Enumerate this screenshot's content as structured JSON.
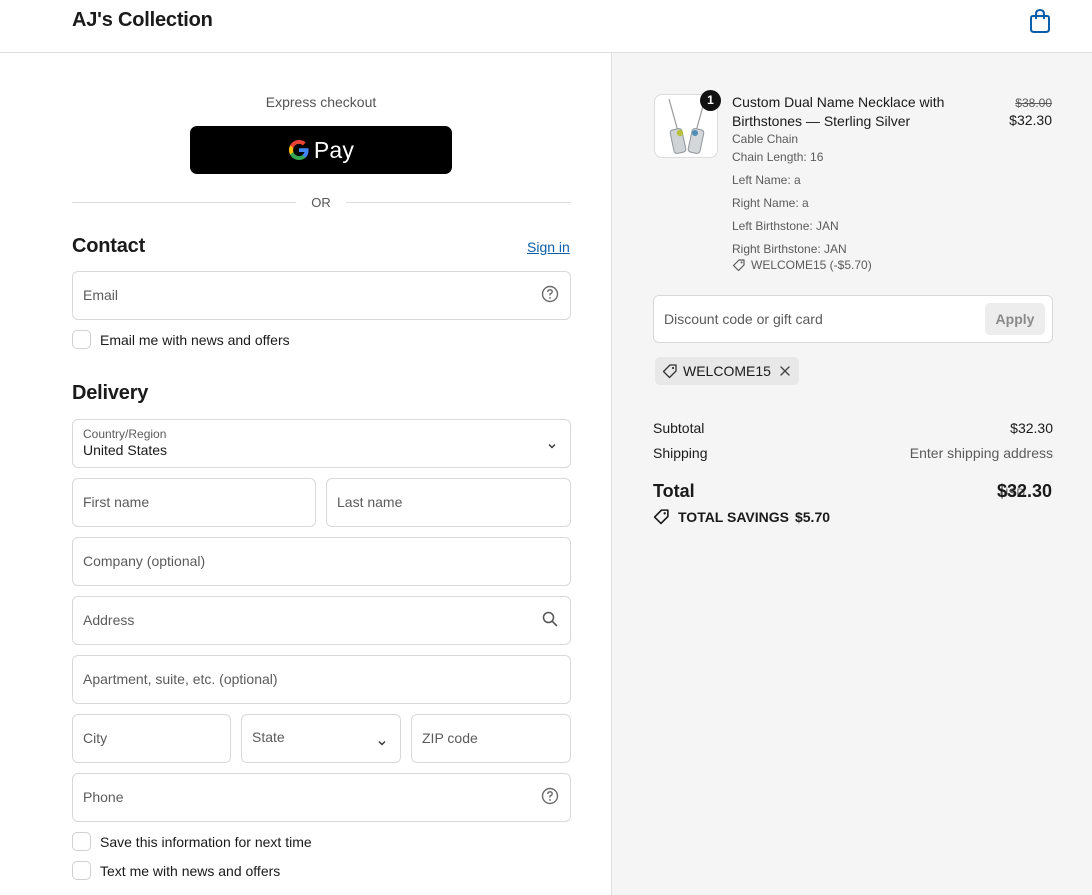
{
  "header": {
    "store_name": "AJ's Collection",
    "cart_icon": "shopping-bag-icon"
  },
  "checkout": {
    "express_label": "Express checkout",
    "gpay_label": "Pay",
    "or_label": "OR"
  },
  "contact": {
    "title": "Contact",
    "signin_label": "Sign in",
    "email_placeholder": "Email",
    "email_offers_label": "Email me with news and offers"
  },
  "delivery": {
    "title": "Delivery",
    "country_label": "Country/Region",
    "country_value": "United States",
    "first_name_placeholder": "First name",
    "last_name_placeholder": "Last name",
    "company_placeholder": "Company (optional)",
    "address_placeholder": "Address",
    "apartment_placeholder": "Apartment, suite, etc. (optional)",
    "city_placeholder": "City",
    "state_placeholder": "State",
    "zip_placeholder": "ZIP code",
    "phone_placeholder": "Phone",
    "save_info_label": "Save this information for next time",
    "text_offers_label": "Text me with news and offers"
  },
  "order": {
    "quantity": "1",
    "product_title": "Custom Dual Name Necklace with Birthstones — Sterling Silver",
    "variants": [
      "Cable Chain",
      "Chain Length: 16",
      "Left Name: a",
      "Right Name: a",
      "Left Birthstone: JAN",
      "Right Birthstone: JAN"
    ],
    "discount_applied": "WELCOME15 (-$5.70)",
    "price_original": "$38.00",
    "price_current": "$32.30"
  },
  "discount": {
    "placeholder": "Discount code or gift card",
    "apply_label": "Apply",
    "code": "WELCOME15"
  },
  "summary": {
    "subtotal_label": "Subtotal",
    "subtotal_value": "$32.30",
    "shipping_label": "Shipping",
    "shipping_value": "Enter shipping address",
    "total_label": "Total",
    "total_currency": "USD",
    "total_value": "$32.30",
    "savings_label": "TOTAL SAVINGS",
    "savings_value": "$5.70"
  },
  "colors": {
    "link": "#0b5ea8",
    "sidebar_bg": "#f5f5f5",
    "button_dark": "#000000"
  }
}
